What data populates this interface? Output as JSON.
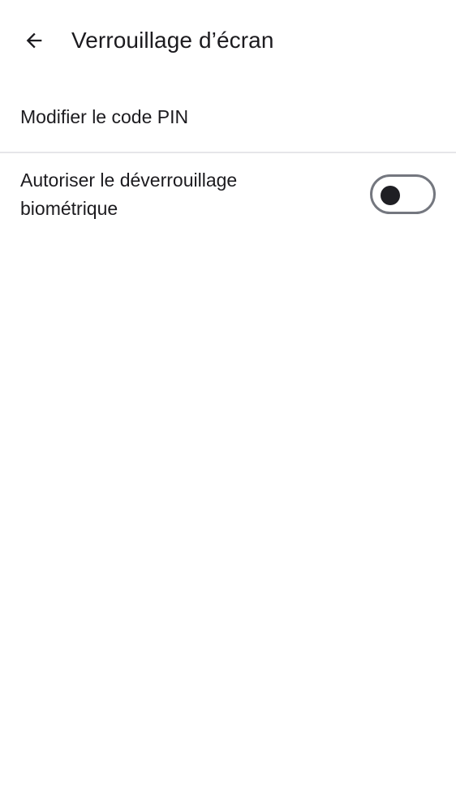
{
  "app_bar": {
    "back_icon": "arrow-back-icon",
    "title": "Verrouillage d’écran"
  },
  "settings": {
    "change_pin_label": "Modifier le code PIN",
    "biometric_label": "Autoriser le déverrouillage biométrique",
    "biometric_enabled": false
  },
  "colors": {
    "background": "#ffffff",
    "text": "#1c1b1f",
    "divider": "#e6e6e9",
    "switch_outline": "#74777f",
    "switch_thumb": "#1f1f24"
  }
}
